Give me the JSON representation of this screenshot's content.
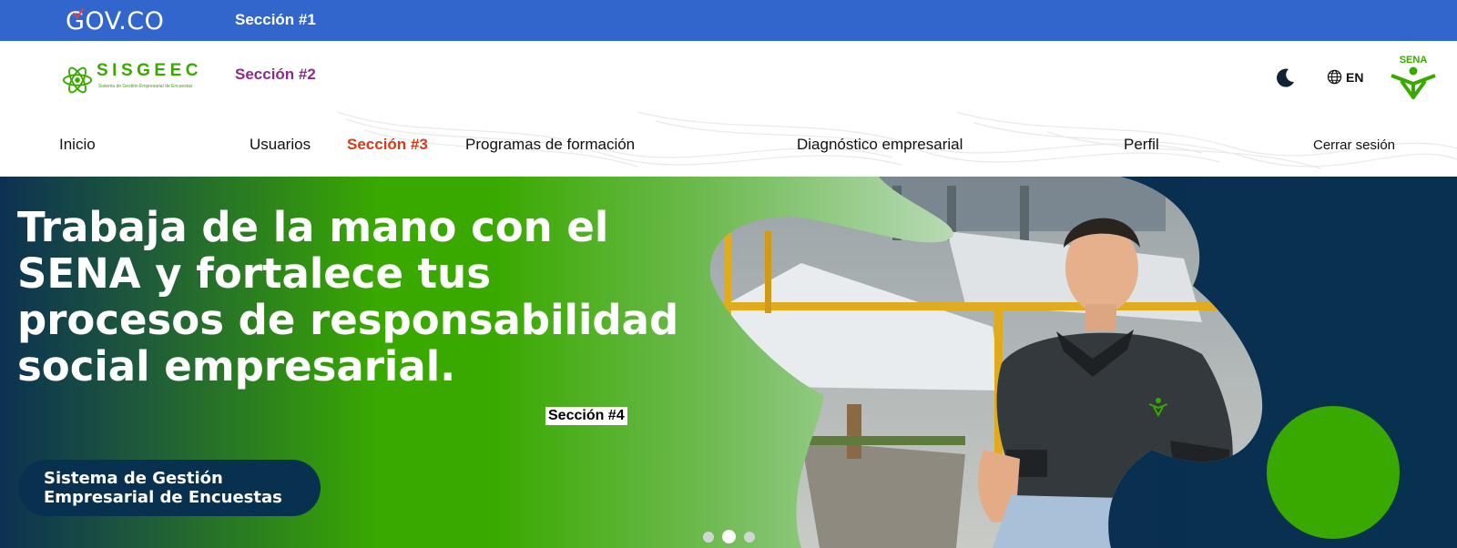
{
  "govbar": {
    "logo_text": "GOV.CO",
    "section_label": "Sección #1",
    "color": "#3366cc"
  },
  "header": {
    "logo_title": "SISGEEC",
    "logo_subtitle": "Sistema de Gestión Empresarial de Encuestas",
    "section_label": "Sección #2",
    "theme_icon": "moon-icon",
    "language_label": "EN",
    "language_icon": "globe-icon",
    "brand_logo": "SENA"
  },
  "nav": {
    "items": [
      {
        "label": "Inicio"
      },
      {
        "label": "Usuarios"
      },
      {
        "label": "Sección #3"
      },
      {
        "label": "Programas de formación"
      },
      {
        "label": "Diagnóstico empresarial"
      },
      {
        "label": "Perfil"
      },
      {
        "label": "Cerrar sesión"
      }
    ]
  },
  "hero": {
    "title": "Trabaja de la mano con el SENA y fortalece tus procesos de responsabilidad social empresarial.",
    "section_label": "Sección #4",
    "pill_line1": "Sistema de Gestión",
    "pill_line2": "Empresarial de Encuestas",
    "carousel": {
      "total": 3,
      "active_index": 1
    },
    "colors": {
      "green": "#39a900",
      "navy": "#08304f"
    }
  }
}
